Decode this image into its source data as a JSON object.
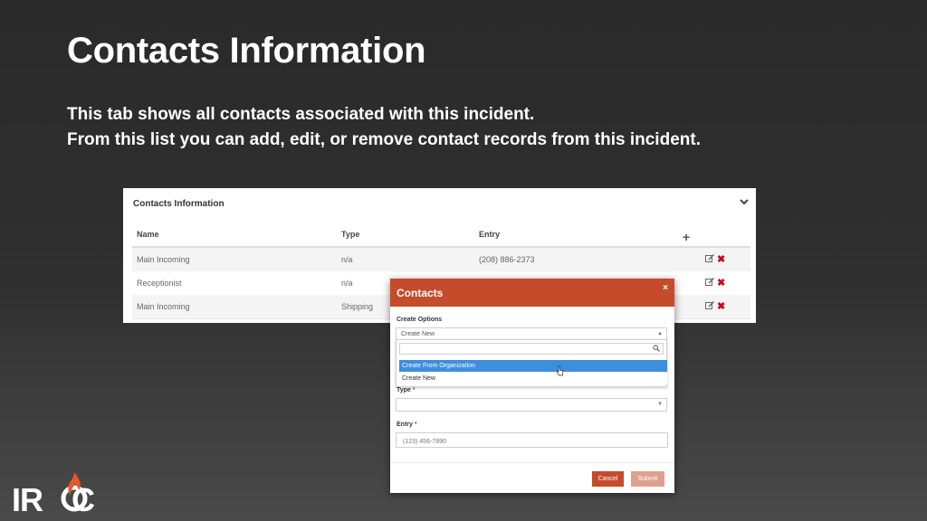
{
  "slide": {
    "title": "Contacts Information",
    "subtitle_line1": "This tab shows all contacts associated with this incident.",
    "subtitle_line2": "From this list you can add, edit, or remove contact records from this incident."
  },
  "panel": {
    "title": "Contacts Information",
    "columns": {
      "name": "Name",
      "type": "Type",
      "entry": "Entry"
    },
    "rows": [
      {
        "name": "Main Incoming",
        "type": "n/a",
        "entry": "(208) 886-2373"
      },
      {
        "name": "Receptionist",
        "type": "n/a",
        "entry": ""
      },
      {
        "name": "Main Incoming",
        "type": "Shipping",
        "entry": ""
      }
    ]
  },
  "modal": {
    "title": "Contacts",
    "close": "×",
    "create_options_label": "Create Options",
    "create_options_value": "Create New",
    "dropdown_options": [
      "Create From Organization",
      "Create New"
    ],
    "type_label": "Type",
    "type_value": "",
    "entry_label": "Entry",
    "entry_placeholder": "(123) 456-7890",
    "required_mark": "*",
    "cancel_label": "Cancel",
    "submit_label": "Submit"
  },
  "logo": {
    "text_left": "IR",
    "text_right": "C"
  },
  "colors": {
    "accent": "#c64b2a",
    "highlight": "#3e8ede",
    "delete": "#d0021b"
  }
}
